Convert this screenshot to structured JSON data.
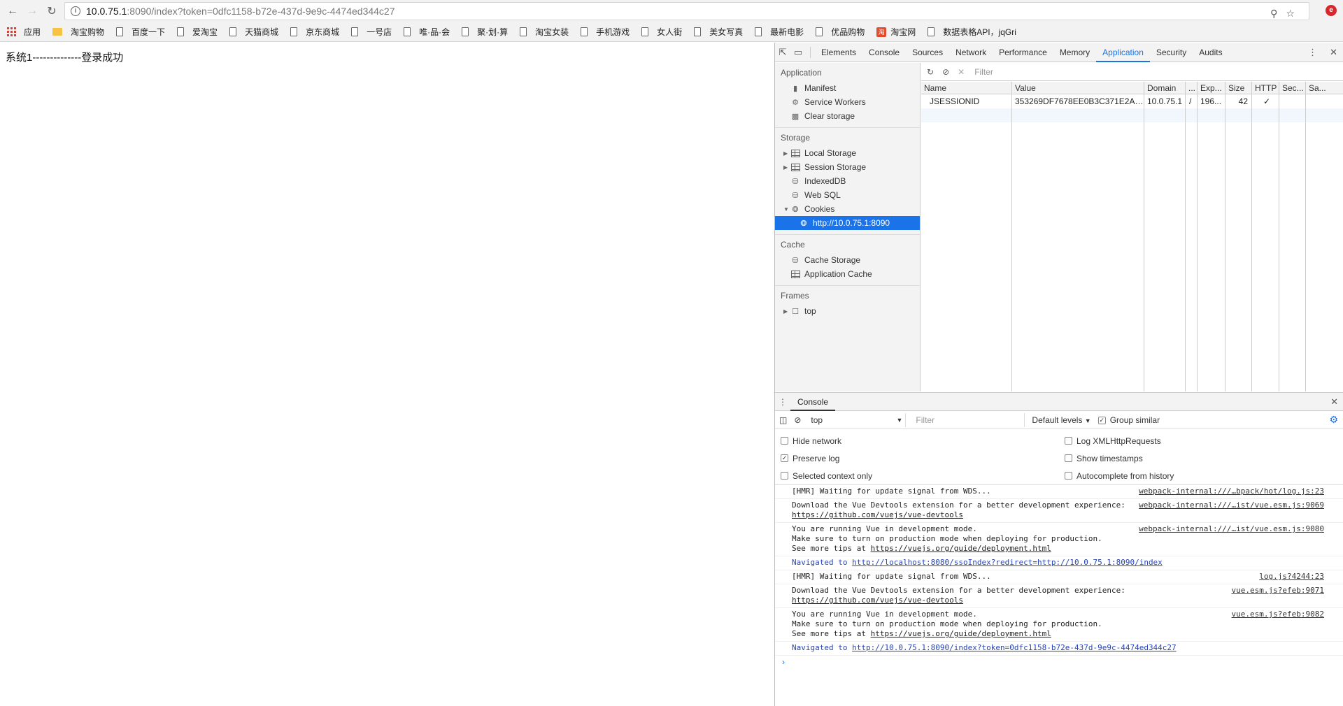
{
  "browser": {
    "url_host": "10.0.75.1",
    "url_rest": ":8090/index?token=0dfc1158-b72e-437d-9e9c-4474ed344c27",
    "bookmarks": [
      "应用",
      "淘宝购物",
      "百度一下",
      "爱淘宝",
      "天猫商城",
      "京东商城",
      "一号店",
      "唯·品·会",
      "聚·划·算",
      "淘宝女装",
      "手机游戏",
      "女人街",
      "美女写真",
      "最新电影",
      "优品购物",
      "淘宝网",
      "数据表格API，jqGri"
    ]
  },
  "page": {
    "text": "系统1--------------登录成功"
  },
  "devtools": {
    "tabs": [
      "Elements",
      "Console",
      "Sources",
      "Network",
      "Performance",
      "Memory",
      "Application",
      "Security",
      "Audits"
    ],
    "active_tab": "Application",
    "sidebar": {
      "application_header": "Application",
      "application_items": [
        "Manifest",
        "Service Workers",
        "Clear storage"
      ],
      "storage_header": "Storage",
      "storage_items": [
        "Local Storage",
        "Session Storage",
        "IndexedDB",
        "Web SQL",
        "Cookies"
      ],
      "cookie_origin": "http://10.0.75.1:8090",
      "cache_header": "Cache",
      "cache_items": [
        "Cache Storage",
        "Application Cache"
      ],
      "frames_header": "Frames",
      "frames_items": [
        "top"
      ]
    },
    "cookie_filter_placeholder": "Filter",
    "cookie_columns": [
      "Name",
      "Value",
      "Domain",
      "...",
      "Exp...",
      "Size",
      "HTTP",
      "Sec...",
      "Sa..."
    ],
    "cookie_rows": [
      [
        "JSESSIONID",
        "353269DF7678EE0B3C371E2AA...",
        "10.0.75.1",
        "/",
        "196...",
        "42",
        "✓",
        "",
        ""
      ]
    ],
    "drawer": {
      "tab": "Console",
      "context": "top",
      "filter_placeholder": "Filter",
      "levels": "Default levels",
      "group_similar": "Group similar",
      "settings_left": [
        {
          "label": "Hide network",
          "checked": false
        },
        {
          "label": "Preserve log",
          "checked": true
        },
        {
          "label": "Selected context only",
          "checked": false
        }
      ],
      "settings_right": [
        {
          "label": "Log XMLHttpRequests",
          "checked": false
        },
        {
          "label": "Show timestamps",
          "checked": false
        },
        {
          "label": "Autocomplete from history",
          "checked": false
        }
      ],
      "messages": [
        {
          "lines": [
            "[HMR] Waiting for update signal from WDS..."
          ],
          "link": "",
          "src": "webpack-internal:///…bpack/hot/log.js:23",
          "nav": false
        },
        {
          "lines": [
            "Download the Vue Devtools extension for a better development experience:"
          ],
          "link": "https://github.com/vuejs/vue-devtools",
          "src": "webpack-internal:///…ist/vue.esm.js:9069",
          "nav": false
        },
        {
          "lines": [
            "You are running Vue in development mode.",
            "Make sure to turn on production mode when deploying for production."
          ],
          "prefix": "See more tips at ",
          "link": "https://vuejs.org/guide/deployment.html",
          "src": "webpack-internal:///…ist/vue.esm.js:9080",
          "nav": false
        },
        {
          "lines": [],
          "prefix": "Navigated to ",
          "link": "http://localhost:8080/ssoIndex?redirect=http://10.0.75.1:8090/index",
          "src": "",
          "nav": true
        },
        {
          "lines": [
            "[HMR] Waiting for update signal from WDS..."
          ],
          "link": "",
          "src": "log.js?4244:23",
          "nav": false
        },
        {
          "lines": [
            "Download the Vue Devtools extension for a better development experience:"
          ],
          "link": "https://github.com/vuejs/vue-devtools",
          "src": "vue.esm.js?efeb:9071",
          "nav": false
        },
        {
          "lines": [
            "You are running Vue in development mode.",
            "Make sure to turn on production mode when deploying for production."
          ],
          "prefix": "See more tips at ",
          "link": "https://vuejs.org/guide/deployment.html",
          "src": "vue.esm.js?efeb:9082",
          "nav": false
        },
        {
          "lines": [],
          "prefix": "Navigated to ",
          "link": "http://10.0.75.1:8090/index?token=0dfc1158-b72e-437d-9e9c-4474ed344c27",
          "src": "",
          "nav": true
        }
      ]
    }
  },
  "colors": {
    "accent": "#1a73e8",
    "nav_message": "#2845b7"
  }
}
